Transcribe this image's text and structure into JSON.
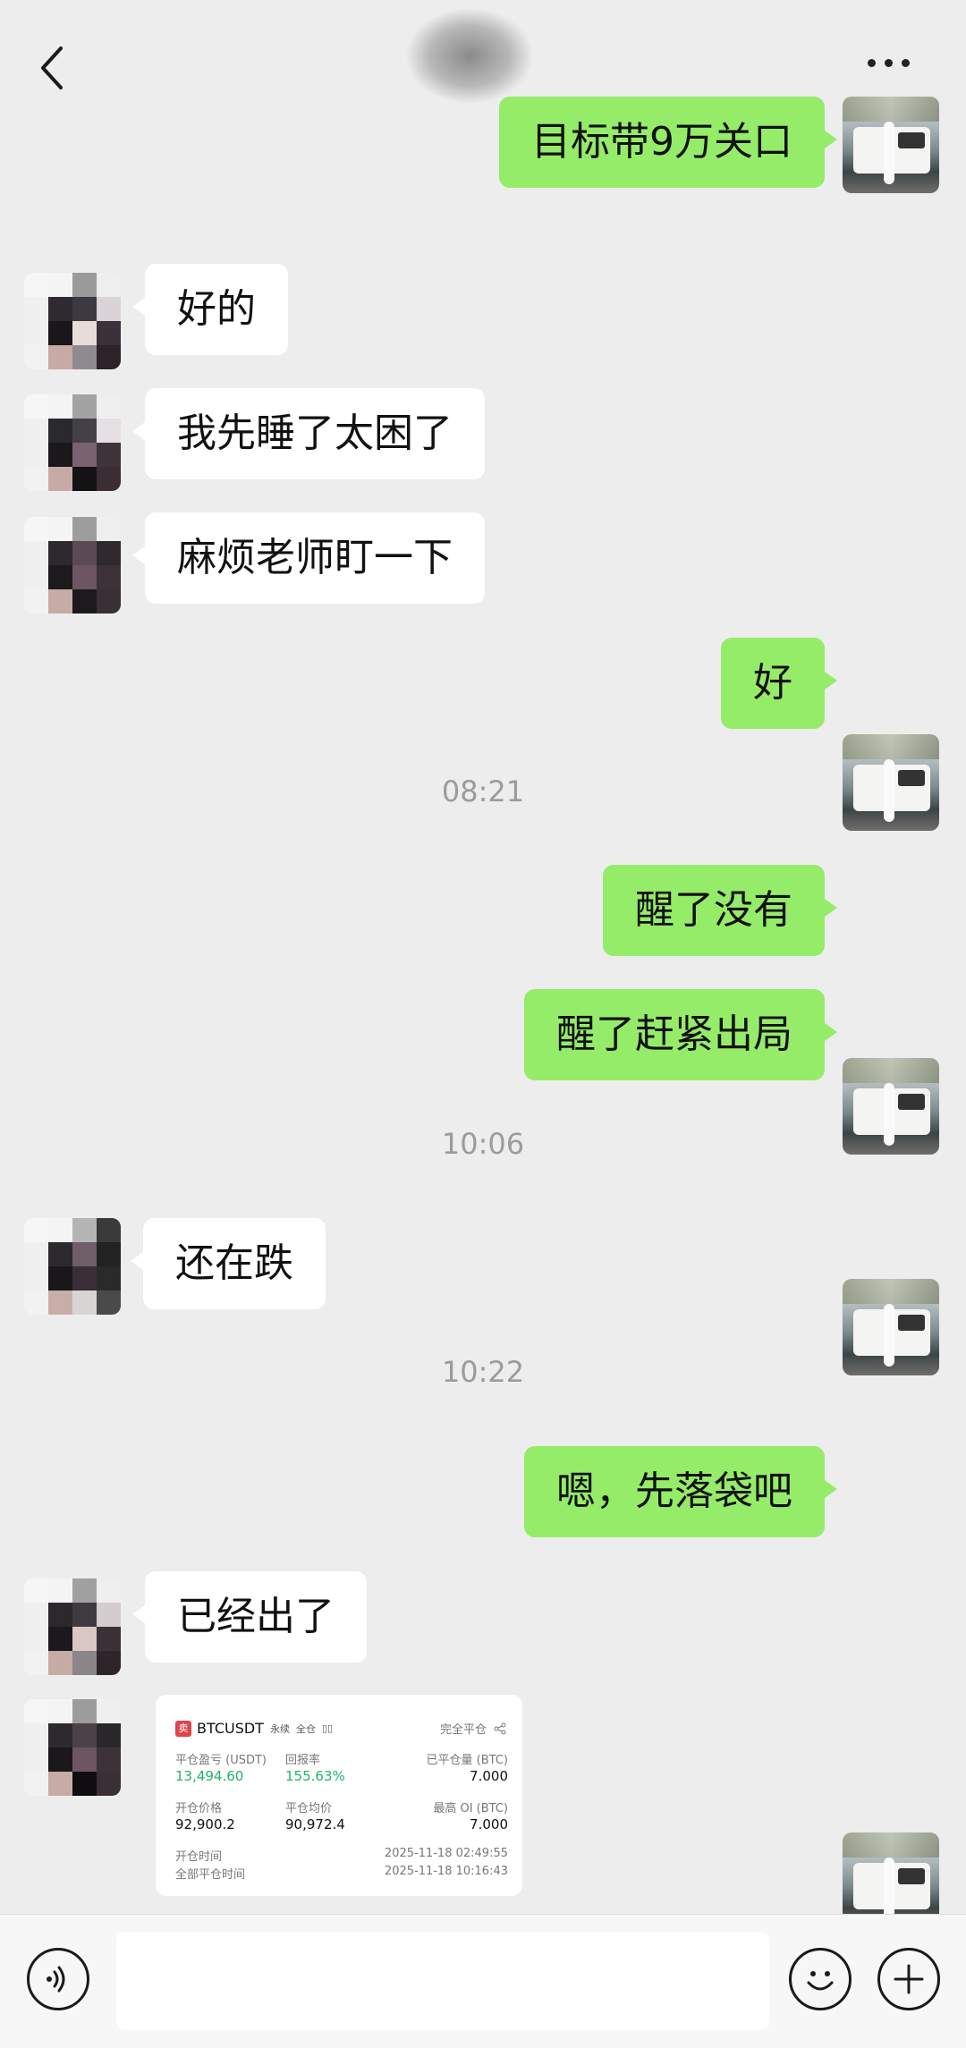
{
  "header": {
    "back_icon": "chevron-left-icon",
    "more_icon": "more-dots-icon"
  },
  "messages": [
    {
      "side": "me",
      "text": "目标带9万关口"
    },
    {
      "side": "other",
      "text": "好的"
    },
    {
      "side": "other",
      "text": "我先睡了太困了"
    },
    {
      "side": "other",
      "text": "麻烦老师盯一下"
    },
    {
      "side": "me",
      "text": "好"
    },
    {
      "time": "08:21"
    },
    {
      "side": "me",
      "text": "醒了没有"
    },
    {
      "side": "me",
      "text": "醒了赶紧出局"
    },
    {
      "time": "10:06"
    },
    {
      "side": "other",
      "text": "还在跌"
    },
    {
      "time": "10:22"
    },
    {
      "side": "me",
      "text": "嗯，先落袋吧"
    },
    {
      "side": "other",
      "text": "已经出了"
    }
  ],
  "trade_card": {
    "symbol": "BTCUSDT",
    "tag_perpetual": "永续",
    "tag_cross": "全仓",
    "leverage_icon": "leverage-icon",
    "status": "完全平仓",
    "share_icon": "share-icon",
    "pnl_label": "平仓盈亏 (USDT)",
    "pnl_value": "13,494.60",
    "roi_label": "回报率",
    "roi_value": "155.63%",
    "closed_qty_label": "已平仓量 (BTC)",
    "closed_qty_value": "7.000",
    "open_price_label": "开仓价格",
    "open_price_value": "92,900.2",
    "avg_close_label": "平仓均价",
    "avg_close_value": "90,972.4",
    "max_oi_label": "最高 OI (BTC)",
    "max_oi_value": "7.000",
    "open_time_label": "开仓时间",
    "open_time_value": "2025-11-18 02:49:55",
    "close_time_label": "全部平仓时间",
    "close_time_value": "2025-11-18 10:16:43"
  },
  "input_bar": {
    "voice_icon": "voice-icon",
    "emoji_icon": "emoji-icon",
    "plus_icon": "plus-icon"
  }
}
